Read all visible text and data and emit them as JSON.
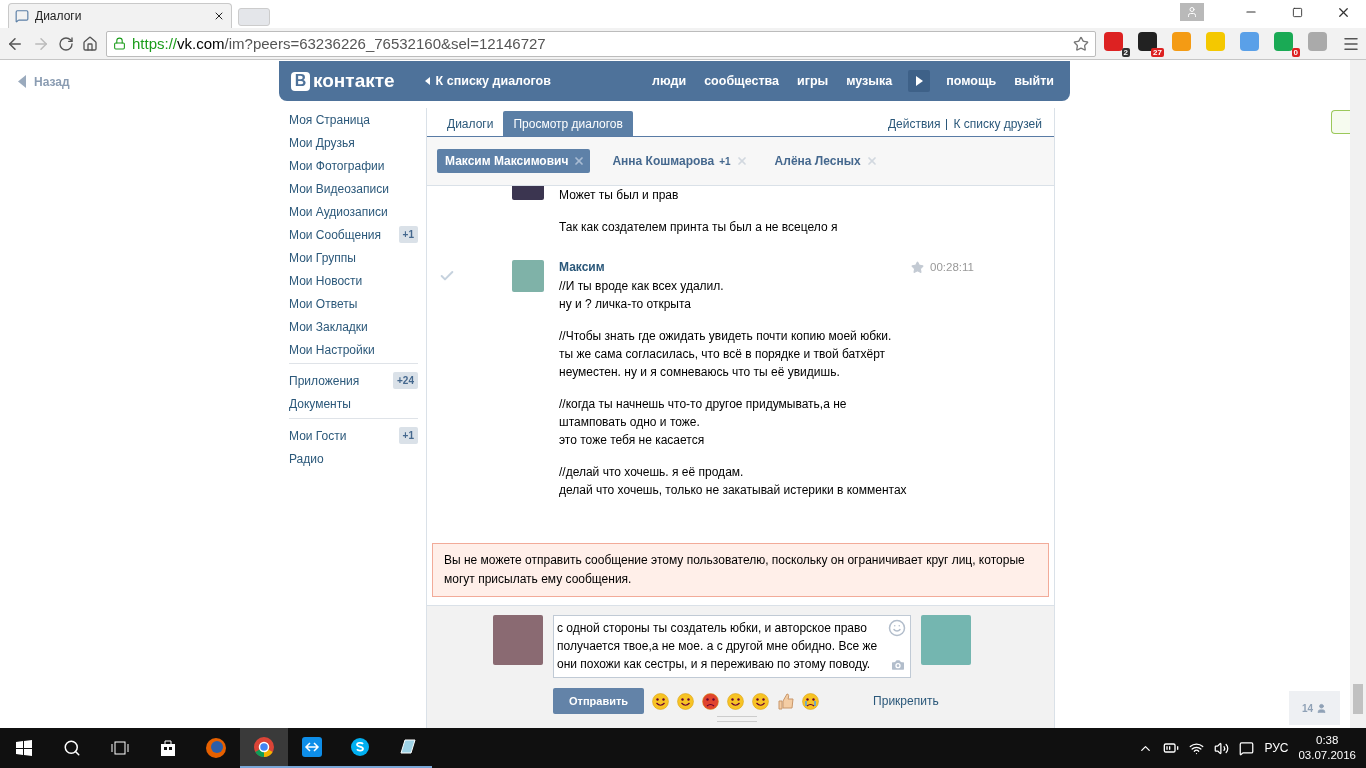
{
  "browser": {
    "tab_title": "Диалоги",
    "url_scheme": "https://",
    "url_host": "vk.com",
    "url_path": "/im?peers=63236226_76532160&sel=12146727",
    "extension_badges": [
      "2",
      "27",
      "0"
    ]
  },
  "back_link": "Назад",
  "header": {
    "logo_letter": "В",
    "logo_text": "контакте",
    "back_to_list": "К списку диалогов",
    "nav": [
      "люди",
      "сообщества",
      "игры",
      "музыка",
      "помощь",
      "выйти"
    ]
  },
  "sidebar": {
    "groups": [
      {
        "items": [
          {
            "label": "Моя Страница"
          },
          {
            "label": "Мои Друзья"
          },
          {
            "label": "Мои Фотографии"
          },
          {
            "label": "Мои Видеозаписи"
          },
          {
            "label": "Мои Аудиозаписи"
          },
          {
            "label": "Мои Сообщения",
            "badge": "+1"
          },
          {
            "label": "Мои Группы"
          },
          {
            "label": "Мои Новости"
          },
          {
            "label": "Мои Ответы"
          },
          {
            "label": "Мои Закладки"
          },
          {
            "label": "Мои Настройки"
          }
        ]
      },
      {
        "items": [
          {
            "label": "Приложения",
            "badge": "+24"
          },
          {
            "label": "Документы"
          }
        ]
      },
      {
        "items": [
          {
            "label": "Мои Гости",
            "badge": "+1"
          },
          {
            "label": "Радио"
          }
        ]
      }
    ]
  },
  "tabs": [
    {
      "label": "Диалоги",
      "selected": false
    },
    {
      "label": "Просмотр диалогов",
      "selected": true
    }
  ],
  "actions": [
    "Действия",
    "К списку друзей"
  ],
  "chats": [
    {
      "name": "Максим Максимович",
      "selected": true
    },
    {
      "name": "Анна Кошмарова",
      "count": "+1",
      "selected": false
    },
    {
      "name": "Алёна Лесных",
      "selected": false
    }
  ],
  "messages": [
    {
      "avatar_cut": true,
      "paragraphs": [
        [
          "Может ты был и прав"
        ],
        [
          "Так как создателем принта ты был а не всецело я"
        ]
      ]
    },
    {
      "author": "Максим",
      "time": "00:28:11",
      "paragraphs": [
        [
          "//И ты вроде как всех удалил.",
          "ну и ? личка-то открыта"
        ],
        [
          "//Чтобы знать где ожидать увидеть почти копию моей юбки.",
          "ты же сама согласилась, что всё в порядке и твой батхёрт",
          "неуместен. ну и я сомневаюсь что ты её увидишь."
        ],
        [
          "//когда ты начнешь что-то другое придумывать,а не",
          "штамповать одно и тоже.",
          "это тоже тебя не касается"
        ],
        [
          "//делай что хочешь. я её продам.",
          "делай что хочешь, только не закатывай истерики в комментах"
        ]
      ]
    }
  ],
  "warning": "Вы не можете отправить сообщение этому пользователю, поскольку он ограничивает круг лиц, которые могут присылать ему сообщения.",
  "compose": {
    "value": "с одной стороны ты создатель юбки, и авторское право получается твое,а не мое. а с другой мне обидно. Все же они похожи как сестры, и я переживаю по этому поводу.",
    "send": "Отправить",
    "attach": "Прикрепить"
  },
  "online_widget": {
    "count": "14"
  },
  "taskbar": {
    "language": "РУС",
    "time": "0:38",
    "date": "03.07.2016"
  }
}
